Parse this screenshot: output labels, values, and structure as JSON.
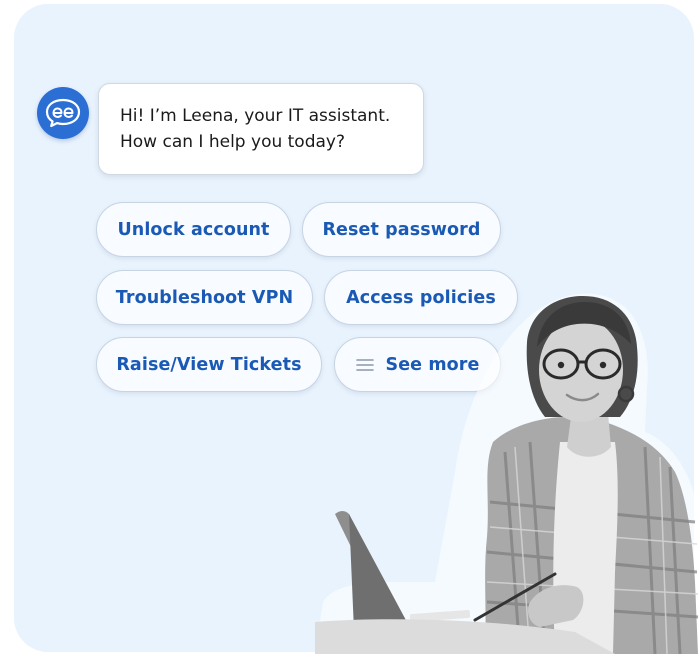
{
  "assistant": {
    "avatar_icon": "chat-bubble-logo-icon",
    "message_line1": "Hi! I’m Leena, your IT assistant.",
    "message_line2": "How can I help you today?"
  },
  "quick_replies": [
    {
      "label": "Unlock account"
    },
    {
      "label": "Reset password"
    },
    {
      "label": "Troubleshoot VPN"
    },
    {
      "label": "Access policies"
    },
    {
      "label": "Raise/View Tickets"
    },
    {
      "label": "See more",
      "icon": "menu-lines-icon"
    }
  ],
  "colors": {
    "background": "#e9f3fd",
    "accent": "#1a5ab5",
    "avatar": "#2b6fd4"
  }
}
